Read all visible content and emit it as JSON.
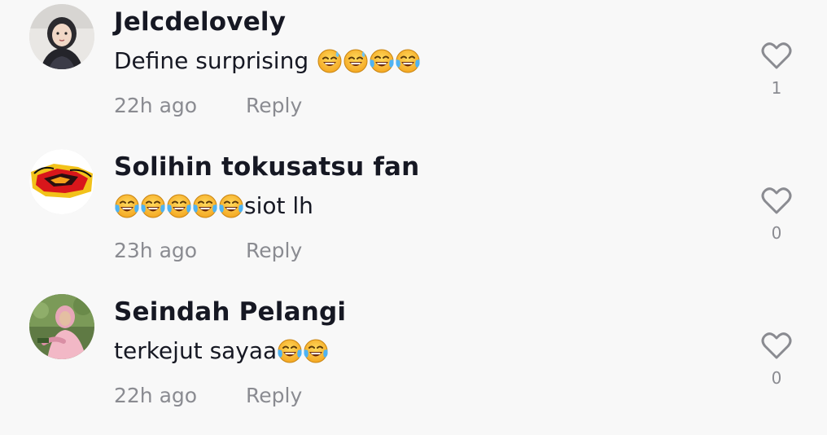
{
  "comments": [
    {
      "username": "Jelcdelovely",
      "text": "Define surprising",
      "emojis_after": [
        "sweat-smile",
        "sweat-smile",
        "joy",
        "joy"
      ],
      "time": "22h ago",
      "reply_label": "Reply",
      "likes": "1"
    },
    {
      "username": "Solihin tokusatsu fan",
      "emojis_before": [
        "joy",
        "joy",
        "joy",
        "joy",
        "joy"
      ],
      "text": "siot lh",
      "time": "23h ago",
      "reply_label": "Reply",
      "likes": "0"
    },
    {
      "username": "Seindah Pelangi",
      "text": "terkejut sayaa",
      "emojis_after": [
        "joy",
        "joy"
      ],
      "time": "22h ago",
      "reply_label": "Reply",
      "likes": "0"
    }
  ],
  "colors": {
    "background": "#f8f8f8",
    "username": "#161823",
    "muted": "#8a8b91",
    "heart_outline": "#8a8b91"
  }
}
